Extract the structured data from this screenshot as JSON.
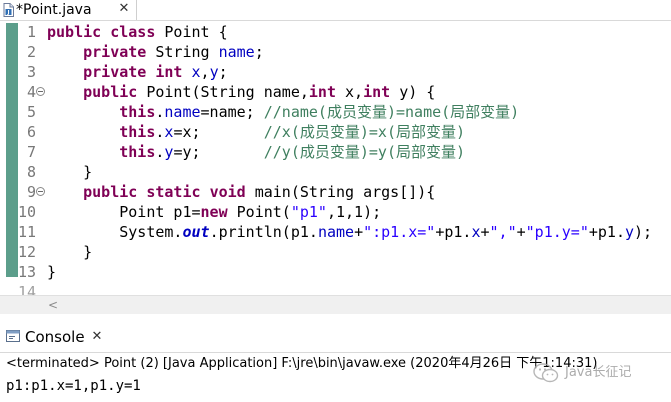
{
  "editor": {
    "tab": {
      "label": "*Point.java",
      "close_glyph": "✕",
      "icon": "java-file-icon"
    },
    "line_numbers": [
      "1",
      "2",
      "3",
      "4",
      "5",
      "6",
      "7",
      "8",
      "9",
      "10",
      "11",
      "12",
      "13",
      "14"
    ],
    "fold_marker_lines": [
      4,
      9
    ],
    "lines": [
      [
        {
          "c": "kw",
          "t": "public"
        },
        {
          "c": "",
          "t": " "
        },
        {
          "c": "kw",
          "t": "class"
        },
        {
          "c": "",
          "t": " Point {"
        }
      ],
      [
        {
          "c": "",
          "t": "    "
        },
        {
          "c": "kw",
          "t": "private"
        },
        {
          "c": "",
          "t": " String "
        },
        {
          "c": "fld",
          "t": "name"
        },
        {
          "c": "",
          "t": ";"
        }
      ],
      [
        {
          "c": "",
          "t": "    "
        },
        {
          "c": "kw",
          "t": "private"
        },
        {
          "c": "",
          "t": " "
        },
        {
          "c": "kw",
          "t": "int"
        },
        {
          "c": "",
          "t": " "
        },
        {
          "c": "fld",
          "t": "x"
        },
        {
          "c": "",
          "t": ","
        },
        {
          "c": "fld",
          "t": "y"
        },
        {
          "c": "",
          "t": ";"
        }
      ],
      [
        {
          "c": "",
          "t": "    "
        },
        {
          "c": "kw",
          "t": "public"
        },
        {
          "c": "",
          "t": " Point(String name,"
        },
        {
          "c": "kw",
          "t": "int"
        },
        {
          "c": "",
          "t": " x,"
        },
        {
          "c": "kw",
          "t": "int"
        },
        {
          "c": "",
          "t": " y) {"
        }
      ],
      [
        {
          "c": "",
          "t": "        "
        },
        {
          "c": "kw",
          "t": "this"
        },
        {
          "c": "",
          "t": "."
        },
        {
          "c": "fld",
          "t": "name"
        },
        {
          "c": "",
          "t": "=name; "
        },
        {
          "c": "cmt",
          "t": "//name(成员变量)=name(局部变量)"
        }
      ],
      [
        {
          "c": "",
          "t": "        "
        },
        {
          "c": "kw",
          "t": "this"
        },
        {
          "c": "",
          "t": "."
        },
        {
          "c": "fld",
          "t": "x"
        },
        {
          "c": "",
          "t": "=x;       "
        },
        {
          "c": "cmt",
          "t": "//x(成员变量)=x(局部变量)"
        }
      ],
      [
        {
          "c": "",
          "t": "        "
        },
        {
          "c": "kw",
          "t": "this"
        },
        {
          "c": "",
          "t": "."
        },
        {
          "c": "fld",
          "t": "y"
        },
        {
          "c": "",
          "t": "=y;       "
        },
        {
          "c": "cmt",
          "t": "//y(成员变量)=y(局部变量)"
        }
      ],
      [
        {
          "c": "",
          "t": "    }"
        }
      ],
      [
        {
          "c": "",
          "t": "    "
        },
        {
          "c": "kw",
          "t": "public"
        },
        {
          "c": "",
          "t": " "
        },
        {
          "c": "kw",
          "t": "static"
        },
        {
          "c": "",
          "t": " "
        },
        {
          "c": "kw",
          "t": "void"
        },
        {
          "c": "",
          "t": " main(String args[]){"
        }
      ],
      [
        {
          "c": "",
          "t": "        Point p1="
        },
        {
          "c": "kw",
          "t": "new"
        },
        {
          "c": "",
          "t": " Point("
        },
        {
          "c": "str",
          "t": "\"p1\""
        },
        {
          "c": "",
          "t": ",1,1);"
        }
      ],
      [
        {
          "c": "",
          "t": "        System."
        },
        {
          "c": "sfld",
          "t": "out"
        },
        {
          "c": "",
          "t": ".println(p1."
        },
        {
          "c": "fld",
          "t": "name"
        },
        {
          "c": "",
          "t": "+"
        },
        {
          "c": "str",
          "t": "\":p1.x=\""
        },
        {
          "c": "",
          "t": "+p1."
        },
        {
          "c": "fld",
          "t": "x"
        },
        {
          "c": "",
          "t": "+"
        },
        {
          "c": "str",
          "t": "\",\""
        },
        {
          "c": "",
          "t": "+"
        },
        {
          "c": "str",
          "t": "\"p1.y=\""
        },
        {
          "c": "",
          "t": "+p1."
        },
        {
          "c": "fld",
          "t": "y"
        },
        {
          "c": "",
          "t": ");"
        }
      ],
      [
        {
          "c": "",
          "t": "    }"
        }
      ],
      [
        {
          "c": "",
          "t": "}"
        }
      ],
      [
        {
          "c": "",
          "t": ""
        }
      ]
    ]
  },
  "scrollbar": {
    "left_arrow_glyph": "<"
  },
  "console": {
    "tab_label": "Console",
    "close_glyph": "✕",
    "icon": "console-icon",
    "status": "<terminated> Point (2) [Java Application] F:\\jre\\bin\\javaw.exe (2020年4月26日 下午1:14:31)",
    "output": "p1:p1.x=1,p1.y=1"
  },
  "watermark": {
    "text": "Java长征记",
    "icon": "wechat-logo-icon"
  },
  "colors": {
    "keyword": "#7f0055",
    "field": "#0000c0",
    "comment": "#3f7f5f",
    "string": "#2a00ff",
    "line_number": "#787878",
    "change_ruler": "#5c9e8b"
  }
}
